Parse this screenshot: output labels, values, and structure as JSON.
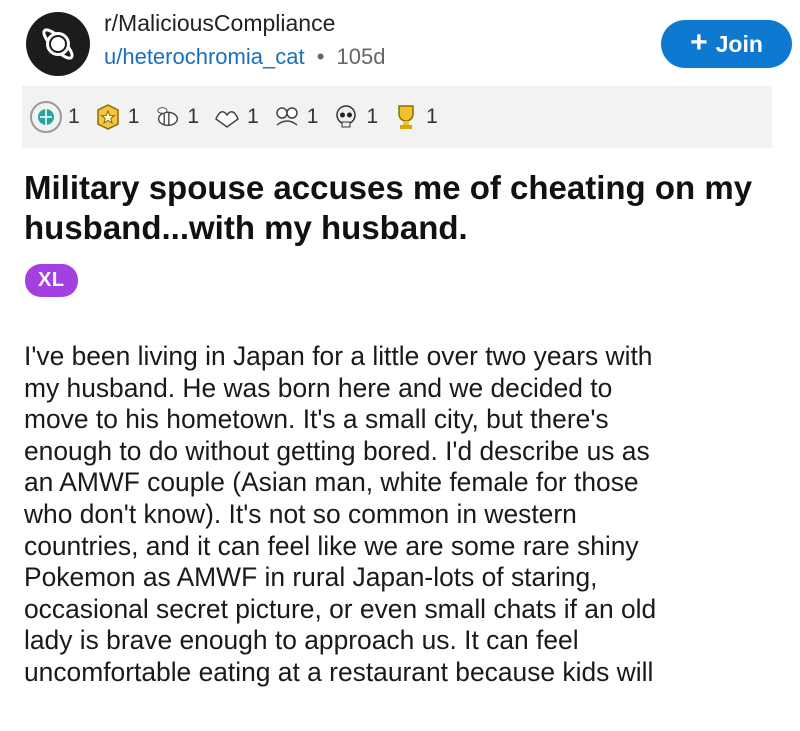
{
  "header": {
    "subreddit": "r/MaliciousCompliance",
    "username": "u/heterochromia_cat",
    "separator": "•",
    "age": "105d",
    "join_label": "Join",
    "join_icon": "plus-icon"
  },
  "awards": [
    {
      "icon": "globe-award-icon",
      "color": "#2aa3a0",
      "count": "1"
    },
    {
      "icon": "star-badge-award-icon",
      "color": "#f0b429",
      "count": "1"
    },
    {
      "icon": "bee-award-icon",
      "color": "#7a7a7a",
      "count": "1"
    },
    {
      "icon": "heart-hands-award-icon",
      "color": "#7a7a7a",
      "count": "1"
    },
    {
      "icon": "hug-award-icon",
      "color": "#7a7a7a",
      "count": "1"
    },
    {
      "icon": "skull-award-icon",
      "color": "#555555",
      "count": "1"
    },
    {
      "icon": "trophy-award-icon",
      "color": "#e0a800",
      "count": "1"
    }
  ],
  "post": {
    "title": "Military spouse accuses me of cheating on my husband...with my husband.",
    "flair": "XL",
    "body_lines": [
      "I've been living in Japan for a little over two years with",
      "my husband. He was born here and we decided to",
      "move to his hometown. It's a small city, but there's",
      "enough to do without getting bored. I'd describe us as",
      "an AMWF couple (Asian man, white female for those",
      "who don't know). It's not so common in western",
      "countries, and it can feel like we are some rare shiny",
      "Pokemon as AMWF in rural Japan-lots of staring,",
      "occasional secret picture, or even small chats if an old",
      "lady is brave enough to approach us. It can feel",
      "uncomfortable eating at a restaurant because kids will"
    ]
  },
  "colors": {
    "join_button": "#0d79d0",
    "username": "#1a6fbd",
    "flair": "#a43fe0",
    "awards_bar": "#f2f2f2"
  }
}
